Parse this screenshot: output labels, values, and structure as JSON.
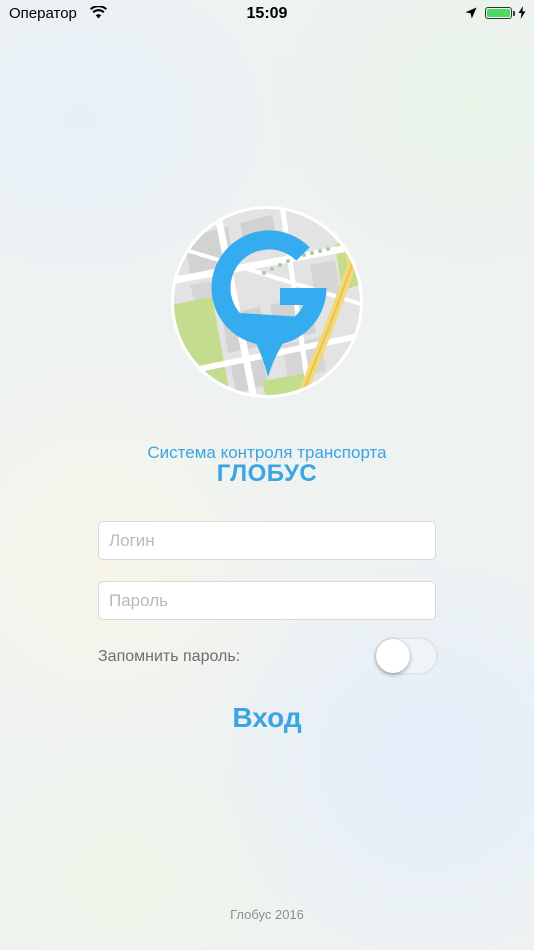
{
  "status_bar": {
    "carrier": "Оператор",
    "time": "15:09",
    "battery_level": 1.0,
    "battery_color": "#4cd964"
  },
  "logo": {
    "icon": "map-pin-g-logo-icon",
    "accent": "#3aa5e2"
  },
  "header": {
    "subtitle": "Система контроля транспорта",
    "title": "ГЛОБУС"
  },
  "form": {
    "login": {
      "value": "",
      "placeholder": "Логин"
    },
    "password": {
      "value": "",
      "placeholder": "Пароль"
    },
    "remember_label": "Запомнить пароль:",
    "remember_on": false,
    "submit_label": "Вход"
  },
  "footer": {
    "text": "Глобус 2016"
  }
}
